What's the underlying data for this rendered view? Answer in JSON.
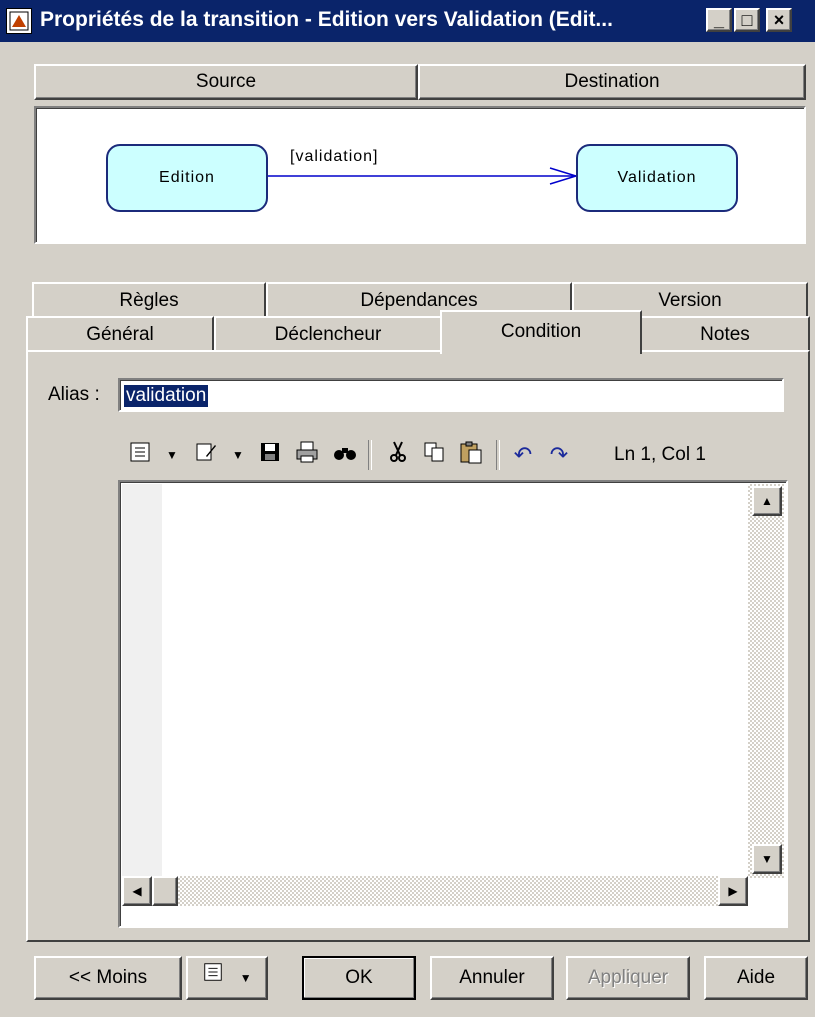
{
  "window": {
    "title": "Propriétés de la transition - Edition vers Validation (Edit...",
    "minimize": "_",
    "maximize": "□",
    "close": "×"
  },
  "header": {
    "source_label": "Source",
    "destination_label": "Destination"
  },
  "diagram": {
    "source_state": "Edition",
    "target_state": "Validation",
    "transition_label": "[validation]"
  },
  "tabs": {
    "row_back": [
      "Règles",
      "Dépendances",
      "Version"
    ],
    "row_front": [
      "Général",
      "Déclencheur",
      "Condition",
      "Notes"
    ],
    "active": "Condition"
  },
  "alias": {
    "label": "Alias :",
    "value": "validation"
  },
  "toolbar": {
    "icons": [
      "properties-menu-icon",
      "edit-menu-icon",
      "save-icon",
      "print-icon",
      "find-icon",
      "cut-icon",
      "copy-icon",
      "paste-icon",
      "undo-icon",
      "redo-icon"
    ],
    "cursor_position": "Ln 1, Col 1"
  },
  "buttons": {
    "less": "<< Moins",
    "ok": "OK",
    "cancel": "Annuler",
    "apply": "Appliquer",
    "help": "Aide"
  },
  "colors": {
    "titlebar": "#0a246a",
    "state_fill": "#ccffff",
    "state_border": "#1b2a7b",
    "edge": "#0000cc"
  }
}
